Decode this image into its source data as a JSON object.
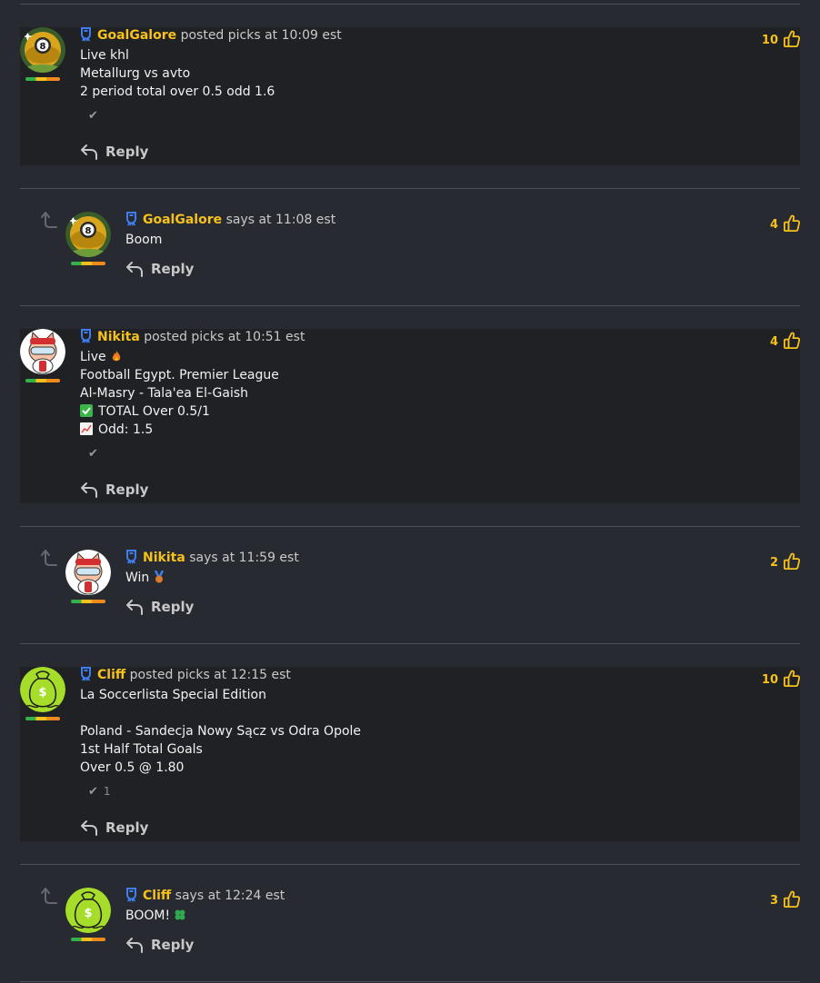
{
  "reply_label": "Reply",
  "colors": {
    "background": "#272a30",
    "post_background": "#1f2125",
    "username": "#f6c11b",
    "likes": "#f6c11b",
    "divider": "#4c5058"
  },
  "icons": {
    "badge": "ribbon-badge-icon",
    "like": "thumbs-up-icon",
    "reply": "reply-arrow-icon",
    "check": "check-icon",
    "thread": "thread-arrow-icon"
  },
  "posts": [
    {
      "user": "GoalGalore",
      "meta": "posted picks at 10:09 est",
      "likes": "10",
      "lines": [
        "Live khl",
        "Metallurg vs avto",
        "2 period total over 0.5 odd 1.6"
      ],
      "check_count": ""
    },
    {
      "user": "GoalGalore",
      "meta": "says at 11:08 est",
      "likes": "4",
      "lines": [
        "Boom"
      ]
    },
    {
      "user": "Nikita",
      "meta": "posted picks at 10:51 est",
      "likes": "4",
      "lines": [
        "Live",
        "Football Egypt. Premier League",
        "Al-Masry - Tala'ea El-Gaish",
        "TOTAL Over 0.5/1",
        "Odd: 1.5"
      ],
      "check_count": ""
    },
    {
      "user": "Nikita",
      "meta": "says at 11:59 est",
      "likes": "2",
      "lines": [
        "Win"
      ]
    },
    {
      "user": "Cliff",
      "meta": "posted picks at 12:15 est",
      "likes": "10",
      "lines": [
        "La Soccerlista Special Edition",
        "",
        "Poland - Sandecja Nowy Sącz vs Odra Opole",
        "1st Half Total Goals",
        "Over 0.5 @ 1.80"
      ],
      "check_count": "1"
    },
    {
      "user": "Cliff",
      "meta": "says at 12:24 est",
      "likes": "3",
      "lines": [
        "BOOM!"
      ]
    }
  ]
}
